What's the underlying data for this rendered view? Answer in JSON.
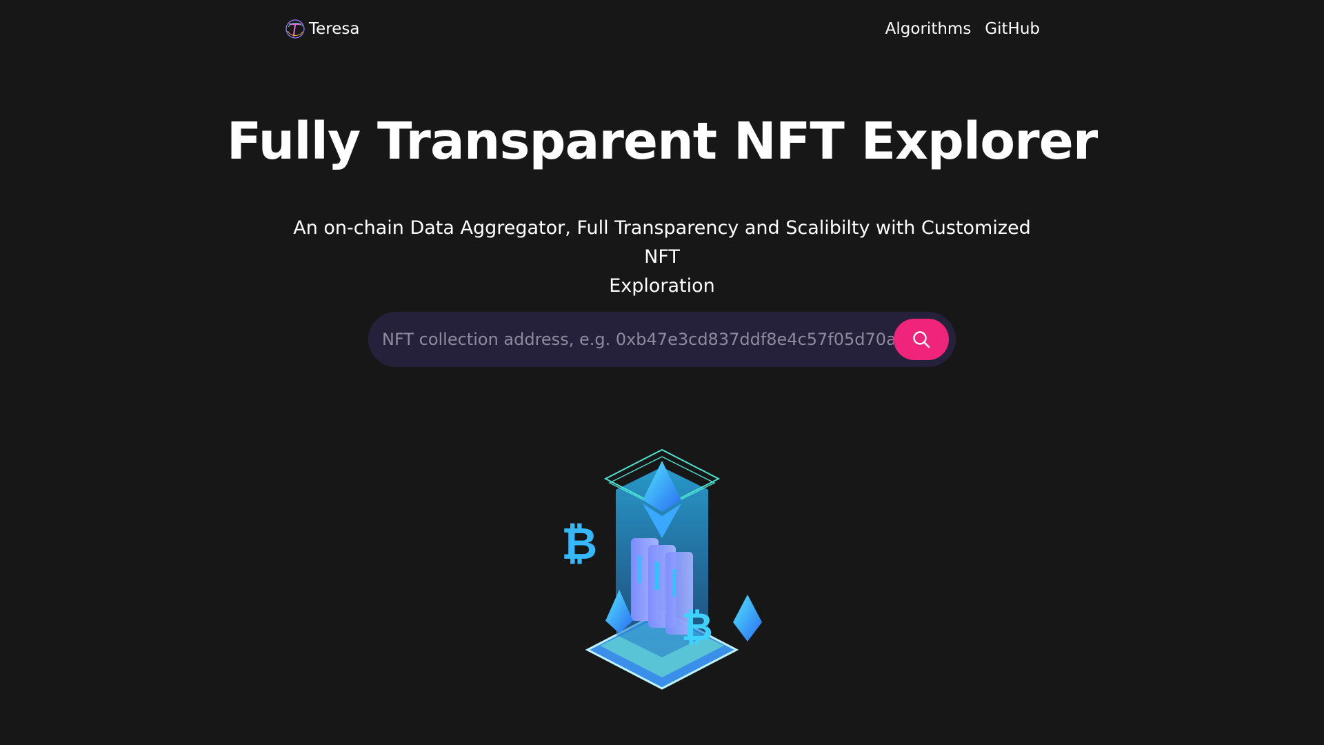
{
  "header": {
    "brand_name": "Teresa",
    "nav": [
      {
        "label": "Algorithms"
      },
      {
        "label": "GitHub"
      }
    ]
  },
  "hero": {
    "title": "Fully Transparent NFT Explorer",
    "subtitle_line1": "An on-chain Data Aggregator, Full Transparency and Scalibilty with Customized NFT",
    "subtitle_line2": "Exploration"
  },
  "search": {
    "placeholder": "NFT collection address, e.g. 0xb47e3cd837ddf8e4c57f05d70a...",
    "value": "",
    "button_icon": "search-icon"
  },
  "illustration": {
    "icon": "crypto-server-illustration"
  },
  "colors": {
    "background": "#171717",
    "search_bg": "#25213b",
    "accent": "#f0247a",
    "text": "#ffffff",
    "placeholder": "#8e8ba0"
  }
}
